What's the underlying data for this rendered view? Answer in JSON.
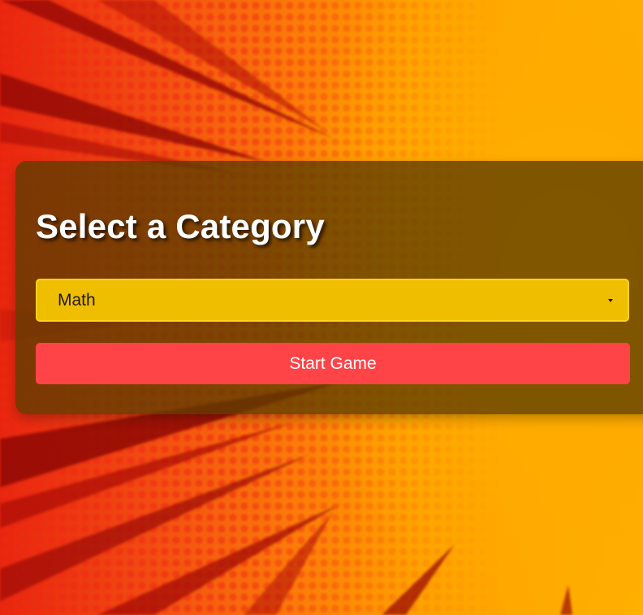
{
  "title": "Select a Category",
  "category_select": {
    "selected": "Math"
  },
  "start_button": {
    "label": "Start Game"
  },
  "colors": {
    "panel": "#5c3c00",
    "select_bg": "#f0be00",
    "button_bg": "#ff4448",
    "background_left": "#e8260f",
    "background_right": "#ffb000"
  }
}
